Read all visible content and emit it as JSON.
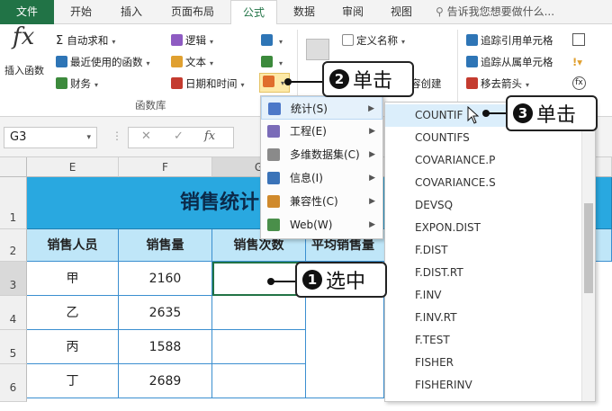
{
  "tabs": [
    "文件",
    "开始",
    "插入",
    "页面布局",
    "公式",
    "数据",
    "审阅",
    "视图"
  ],
  "tell_me": "告诉我您想要做什么...",
  "ribbon": {
    "insert_fn": "插入函数",
    "autosum": "自动求和",
    "recent": "最近使用的函数",
    "finance": "财务",
    "logic": "逻辑",
    "text": "文本",
    "datetime": "日期和时间",
    "group_label": "函数库",
    "define_name": "定义名称",
    "from_selection": "容创建",
    "trace_precedents": "追踪引用单元格",
    "trace_dependents": "追踪从属单元格",
    "remove_arrows": "移去箭头"
  },
  "formula_bar": {
    "name_box": "G3",
    "fx": "fx"
  },
  "columns": [
    "E",
    "F",
    "G"
  ],
  "rows": [
    "1",
    "2",
    "3",
    "4",
    "5",
    "6"
  ],
  "sheet": {
    "title": "销售统计",
    "headers": [
      "销售人员",
      "销售量",
      "销售次数",
      "平均销售量"
    ],
    "data": [
      [
        "甲",
        "2160"
      ],
      [
        "乙",
        "2635"
      ],
      [
        "丙",
        "1588"
      ],
      [
        "丁",
        "2689"
      ]
    ]
  },
  "submenu": [
    {
      "label": "统计(S)",
      "icon": "statistics-icon"
    },
    {
      "label": "工程(E)",
      "icon": "engineering-icon"
    },
    {
      "label": "多维数据集(C)",
      "icon": "cube-icon"
    },
    {
      "label": "信息(I)",
      "icon": "info-icon"
    },
    {
      "label": "兼容性(C)",
      "icon": "compatibility-icon"
    },
    {
      "label": "Web(W)",
      "icon": "web-icon"
    }
  ],
  "functions": [
    "COUNTIF",
    "COUNTIFS",
    "COVARIANCE.P",
    "COVARIANCE.S",
    "DEVSQ",
    "EXPON.DIST",
    "F.DIST",
    "F.DIST.RT",
    "F.INV",
    "F.INV.RT",
    "F.TEST",
    "FISHER",
    "FISHERINV"
  ],
  "callouts": {
    "c1": {
      "num": "1",
      "text": "选中"
    },
    "c2": {
      "num": "2",
      "text": "单击"
    },
    "c3": {
      "num": "3",
      "text": "单击"
    }
  },
  "colors": {
    "excel_green": "#217346",
    "header_fill": "#bfe6f8",
    "title_fill": "#29a8e0"
  }
}
